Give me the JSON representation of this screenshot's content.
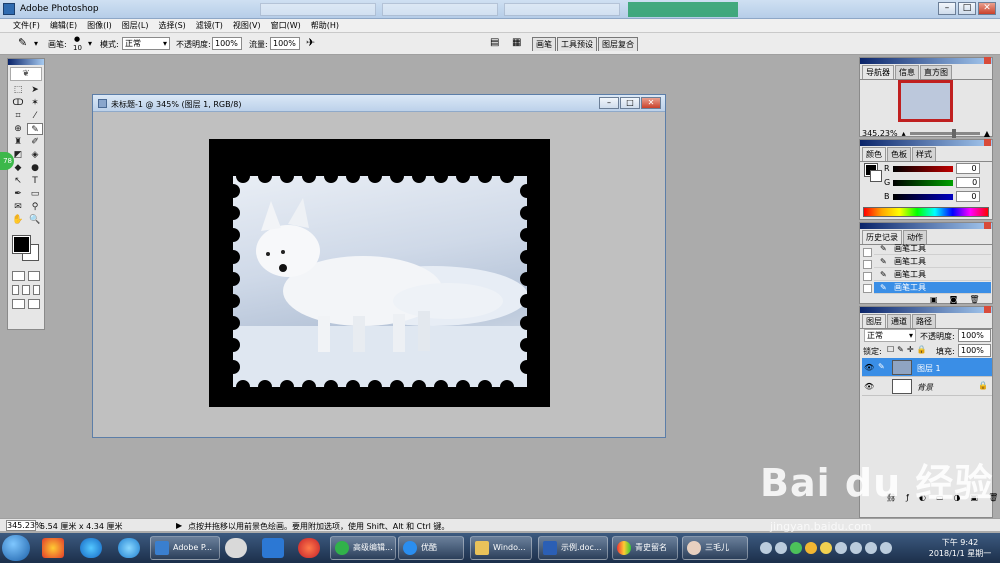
{
  "app": {
    "title": "Adobe Photoshop"
  },
  "window_buttons": {
    "minimize": "–",
    "maximize": "□",
    "close": "✕"
  },
  "menu": [
    "文件(F)",
    "编辑(E)",
    "图像(I)",
    "图层(L)",
    "选择(S)",
    "滤镜(T)",
    "视图(V)",
    "窗口(W)",
    "帮助(H)"
  ],
  "options": {
    "brush_label": "画笔:",
    "brush_size": "10",
    "mode_label": "模式:",
    "mode_value": "正常",
    "opacity_label": "不透明度:",
    "opacity_value": "100%",
    "flow_label": "流量:",
    "flow_value": "100%"
  },
  "wells": [
    "画笔",
    "工具预设",
    "图层复合"
  ],
  "badge": "78",
  "document": {
    "title": "未标题-1 @ 345% (图层 1, RGB/8)"
  },
  "navigator": {
    "tabs": [
      "导航器",
      "信息",
      "直方图"
    ],
    "zoom": "345.23%"
  },
  "color_panel": {
    "tabs": [
      "颜色",
      "色板",
      "样式"
    ],
    "channels": [
      {
        "label": "R",
        "value": "0",
        "color": "#c00000"
      },
      {
        "label": "G",
        "value": "0",
        "color": "#00a000"
      },
      {
        "label": "B",
        "value": "0",
        "color": "#0000c0"
      }
    ]
  },
  "history": {
    "tabs": [
      "历史记录",
      "动作"
    ],
    "items": [
      "画笔工具",
      "画笔工具",
      "画笔工具",
      "画笔工具"
    ]
  },
  "layers": {
    "tabs": [
      "图层",
      "通道",
      "路径"
    ],
    "blend_mode": "正常",
    "opacity_label": "不透明度:",
    "opacity_value": "100%",
    "lock_label": "锁定:",
    "fill_label": "填充:",
    "fill_value": "100%",
    "items": [
      {
        "name": "图层 1",
        "selected": true
      },
      {
        "name": "背景",
        "selected": false
      }
    ]
  },
  "status": {
    "zoom": "345.23%",
    "doc_size": "5.54 厘米 x 4.34 厘米",
    "hint": "点按并拖移以用前景色绘画。要用附加选项，使用 Shift、Alt 和 Ctrl 键。"
  },
  "taskbar": {
    "buttons": [
      "Adobe P...",
      "高级编辑...",
      "优酷",
      "Windo...",
      "示例.doc...",
      "青史留名",
      "三毛儿"
    ],
    "time": "下午 9:42",
    "date": "2018/1/1 星期一"
  },
  "watermark": {
    "logo": "Bai du 经验",
    "url": "jingyan.baidu.com"
  },
  "colors": {
    "accent": "#3a8ee6",
    "brand": "#0a246a"
  }
}
